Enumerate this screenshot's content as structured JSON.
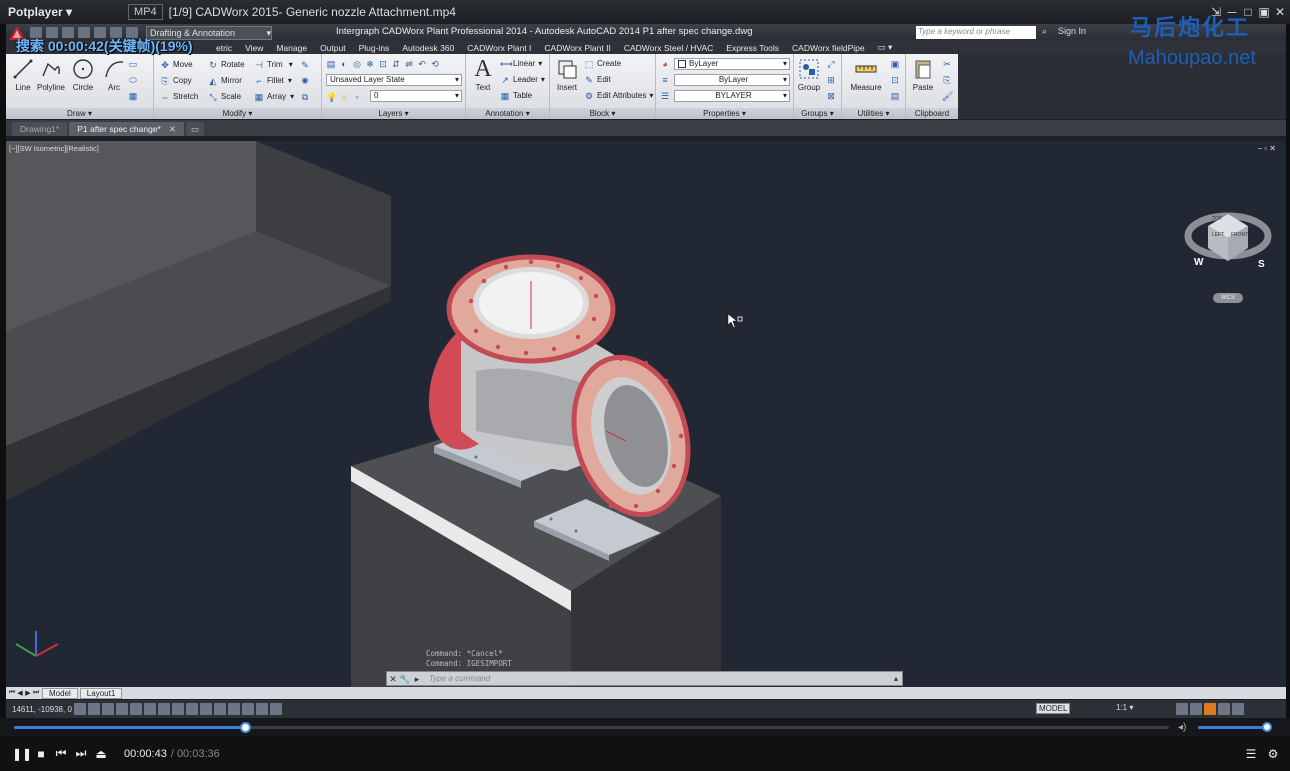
{
  "player": {
    "brand": "Potplayer ▾",
    "format": "MP4",
    "title": "[1/9] CADWorx 2015- Generic nozzle Attachment.mp4",
    "overlay_time": "搜索 00:00:42(关键帧)(19%)",
    "current_time": "00:00:43",
    "total_time": "/ 00:03:36",
    "progress_fraction": 0.2,
    "volume_fraction": 0.95
  },
  "watermark": {
    "cn": "马后炮化工",
    "url": "Mahoupao.net"
  },
  "cad": {
    "workspace": "Drafting & Annotation",
    "window_title": "Intergraph CADWorx Plant Professional 2014 - Autodesk AutoCAD 2014    P1 after spec change.dwg",
    "search_placeholder": "Type a keyword or phrase",
    "signin": "Sign In",
    "menus": [
      "etric",
      "View",
      "Manage",
      "Output",
      "Plug-ins",
      "Autodesk 360",
      "CADWorx Plant I",
      "CADWorx Plant II",
      "CADWorx Steel / HVAC",
      "Express Tools",
      "CADWorx fieldPipe"
    ],
    "ribbon": {
      "draw": {
        "title": "Draw ▾",
        "line": "Line",
        "polyline": "Polyline",
        "circle": "Circle",
        "arc": "Arc"
      },
      "modify": {
        "title": "Modify ▾",
        "move": "Move",
        "rotate": "Rotate",
        "trim": "Trim",
        "copy": "Copy",
        "mirror": "Mirror",
        "fillet": "Fillet",
        "stretch": "Stretch",
        "scale": "Scale",
        "array": "Array"
      },
      "layers": {
        "title": "Layers ▾",
        "layer_state": "Unsaved Layer State",
        "layer": "0"
      },
      "annotation": {
        "title": "Annotation ▾",
        "text": "Text",
        "linear": "Linear",
        "leader": "Leader",
        "table": "Table"
      },
      "block": {
        "title": "Block ▾",
        "insert": "Insert",
        "create": "Create",
        "edit": "Edit",
        "edit_attributes": "Edit Attributes"
      },
      "properties": {
        "title": "Properties ▾",
        "color": "ByLayer",
        "linetype": "ByLayer",
        "lineweight": "BYLAYER"
      },
      "groups": {
        "title": "Groups ▾",
        "group": "Group"
      },
      "utilities": {
        "title": "Utilities ▾",
        "measure": "Measure"
      },
      "clipboard": {
        "title": "Clipboard",
        "paste": "Paste"
      }
    },
    "doc_tabs": [
      "Drawing1*",
      "P1 after spec change*"
    ],
    "viewport_label": "[−][SW Isometric][Realistic]",
    "viewport_controls": "− ▫ ✕",
    "viewcube": {
      "top": "TOP",
      "left": "LEFT",
      "front": "FRONT",
      "w": "W",
      "s": "S",
      "wcs": "WCS"
    },
    "command_history": [
      "Command: *Cancel*",
      "Command: IGESIMPORT"
    ],
    "command_placeholder": "Type a command",
    "layout_tabs": [
      "Model",
      "Layout1"
    ],
    "coords": "14611, -10938, 0",
    "model_label": "MODEL",
    "scale_label": "1:1 ▾"
  },
  "colors": {
    "accent": "#3b7fd4",
    "flange": "#d24a55",
    "pipe": "#c8c8c8",
    "background": "#222833"
  }
}
